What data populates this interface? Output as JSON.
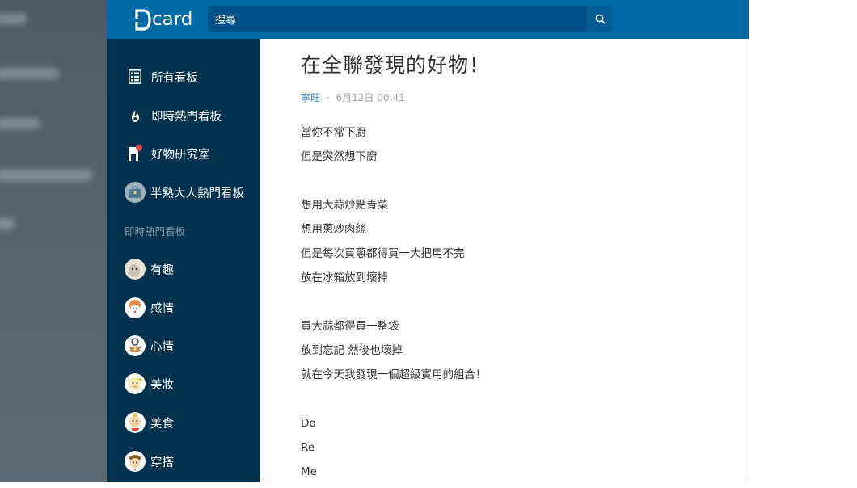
{
  "header": {
    "logo_text": "card",
    "search_placeholder": "搜尋",
    "brand_color": "#006aa6"
  },
  "sidebar": {
    "main_items": [
      {
        "label": "所有看板",
        "icon": "list-icon"
      },
      {
        "label": "即時熱門看板",
        "icon": "flame-icon"
      },
      {
        "label": "好物研究室",
        "icon": "shop-icon"
      },
      {
        "label": "半熟大人熱門看板",
        "icon": "briefcase-avatar"
      }
    ],
    "section_label": "即時熱門看板",
    "boards": [
      {
        "label": "有趣"
      },
      {
        "label": "感情"
      },
      {
        "label": "心情"
      },
      {
        "label": "美妝"
      },
      {
        "label": "美食"
      },
      {
        "label": "穿搭"
      }
    ]
  },
  "post": {
    "title": "在全聯發現的好物！",
    "author": "寧旺",
    "separator": "·",
    "date": "6月12日 00:41",
    "lines": [
      "當你不常下廚",
      "但是突然想下廚",
      "",
      "想用大蒜炒點青菜",
      "想用蔥炒肉絲",
      "但是每次買蔥都得買一大把用不完",
      "放在冰箱放到壞掉",
      "",
      "買大蒜都得買一整袋",
      "放到忘記 然後也壞掉",
      "就在今天我發現一個超級實用的組合！",
      "",
      "Do",
      "Re",
      "Me"
    ]
  }
}
